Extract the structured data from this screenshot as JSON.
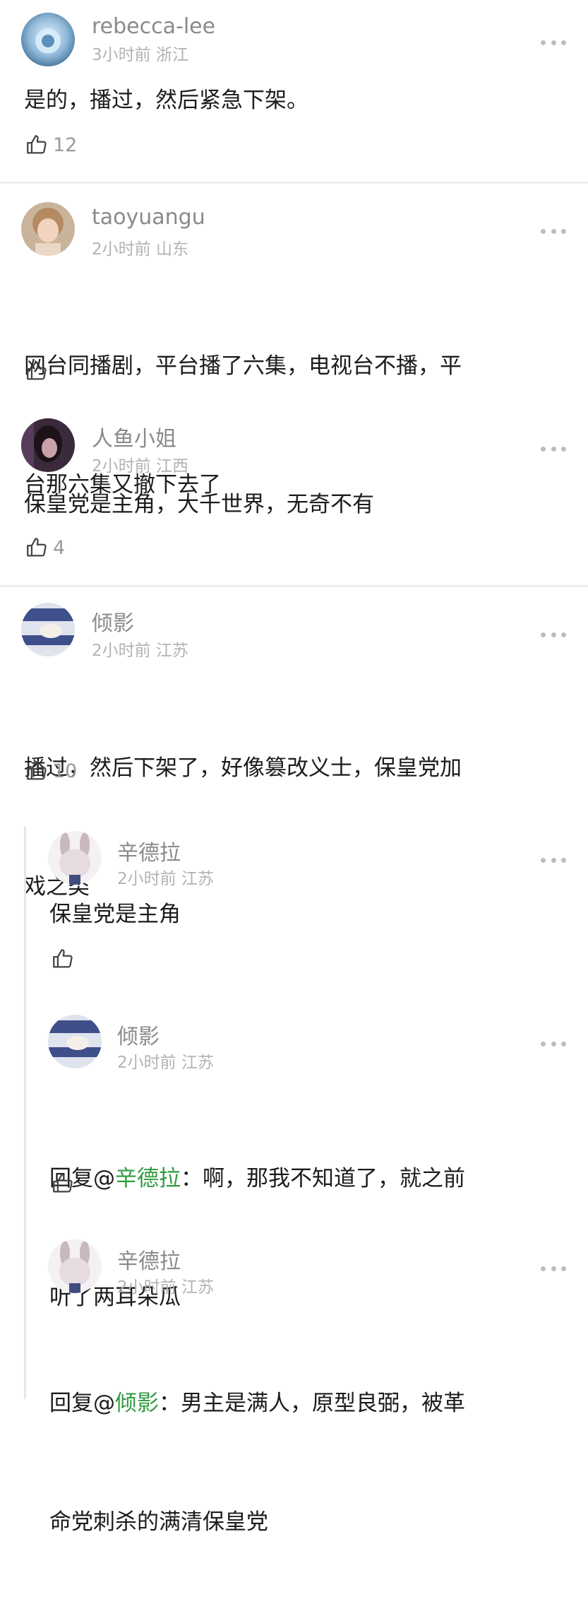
{
  "comments": [
    {
      "username": "rebecca-lee",
      "time": "3小时前",
      "location": "浙江",
      "text": "是的，播过，然后紧急下架。",
      "likes": "12"
    },
    {
      "username": "taoyuangu",
      "time": "2小时前",
      "location": "山东",
      "text_line1": "网台同播剧，平台播了六集，电视台不播，平",
      "text_line2": "台那六集又撤下去了",
      "likes": ""
    },
    {
      "username": "人鱼小姐",
      "time": "2小时前",
      "location": "江西",
      "text": "保皇党是主角，大千世界，无奇不有",
      "likes": "4"
    },
    {
      "username": "倾影",
      "time": "2小时前",
      "location": "江苏",
      "text_line1": "播过，然后下架了，好像篡改义士，保皇党加",
      "text_line2": "戏之类",
      "likes": "10"
    }
  ],
  "replies": [
    {
      "username": "辛德拉",
      "time": "2小时前",
      "location": "江苏",
      "text": "保皇党是主角",
      "likes": ""
    },
    {
      "username": "倾影",
      "time": "2小时前",
      "location": "江苏",
      "reply_prefix": "回复@",
      "mention": "辛德拉",
      "text_line1_rest": "：啊，那我不知道了，就之前",
      "text_line2": "听了两耳朵瓜",
      "likes": ""
    },
    {
      "username": "辛德拉",
      "time": "2小时前",
      "location": "江苏",
      "reply_prefix": "回复@",
      "mention": "倾影",
      "text_line1_rest": "：男主是满人，原型良弼，被革",
      "text_line2": "命党刺杀的满清保皇党",
      "likes": ""
    }
  ],
  "icons": {
    "like": "thumbs-up-icon",
    "more": "more-dots-icon"
  },
  "colors": {
    "mention": "#2f9a3f",
    "username": "#8a8a8a",
    "meta": "#b3b3b3"
  }
}
